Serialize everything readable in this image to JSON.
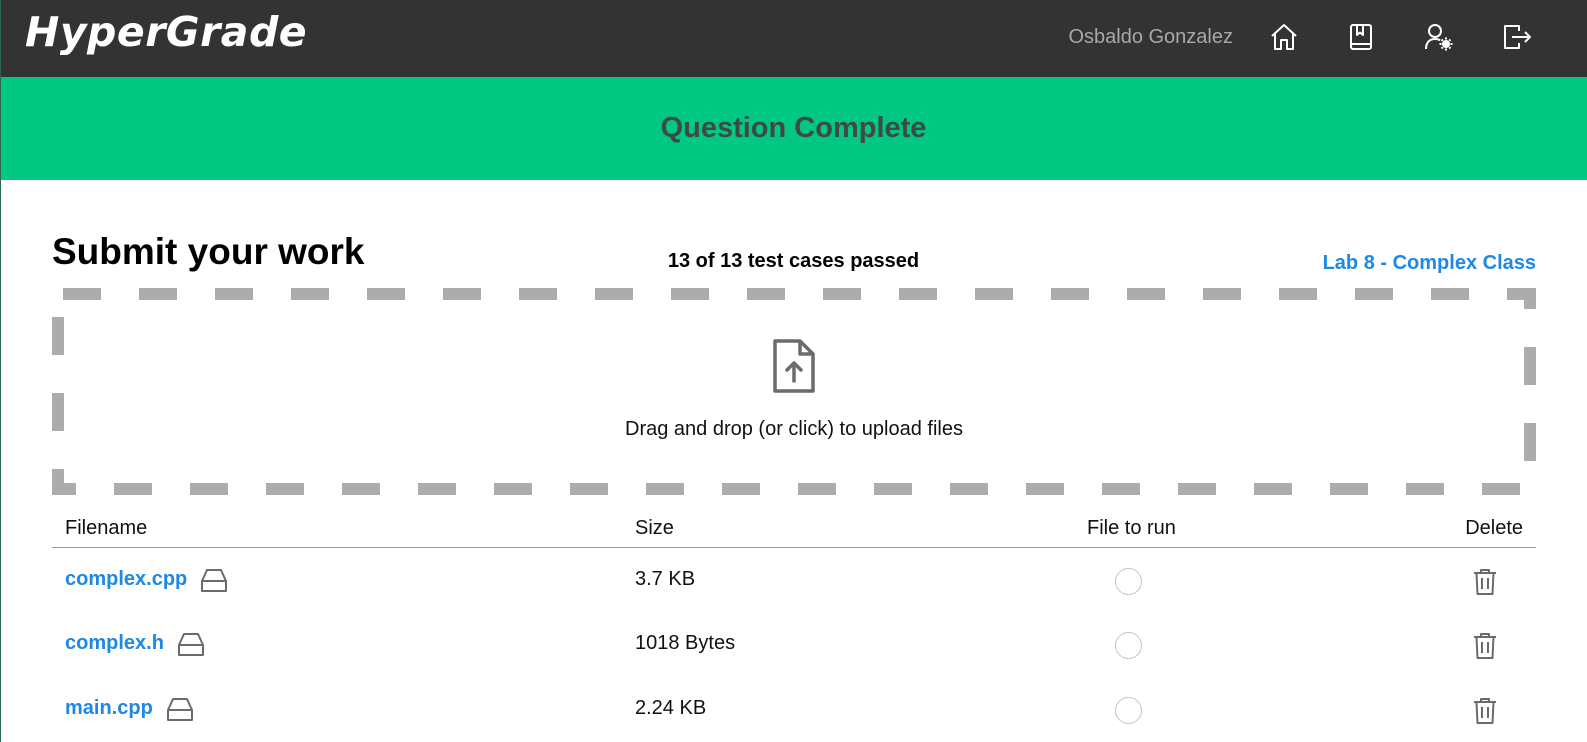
{
  "header": {
    "logo": "HyperGrade",
    "username": "Osbaldo Gonzalez",
    "icons": [
      "home-icon",
      "book-icon",
      "user-settings-icon",
      "logout-icon"
    ]
  },
  "banner": {
    "title": "Question Complete",
    "color": "#00c781"
  },
  "main": {
    "title": "Submit your work",
    "status": "13 of 13 test cases passed",
    "lab_link": "Lab 8 - Complex Class",
    "dropzone_text": "Drag and drop (or click) to upload files"
  },
  "table": {
    "columns": [
      "Filename",
      "Size",
      "File to run",
      "Delete"
    ],
    "rows": [
      {
        "filename": "complex.cpp",
        "size": "3.7 KB",
        "selected": false
      },
      {
        "filename": "complex.h",
        "size": "1018 Bytes",
        "selected": false
      },
      {
        "filename": "main.cpp",
        "size": "2.24 KB",
        "selected": false
      }
    ]
  },
  "colors": {
    "topbar": "#333333",
    "accent": "#1e88e5",
    "banner": "#00c781"
  }
}
